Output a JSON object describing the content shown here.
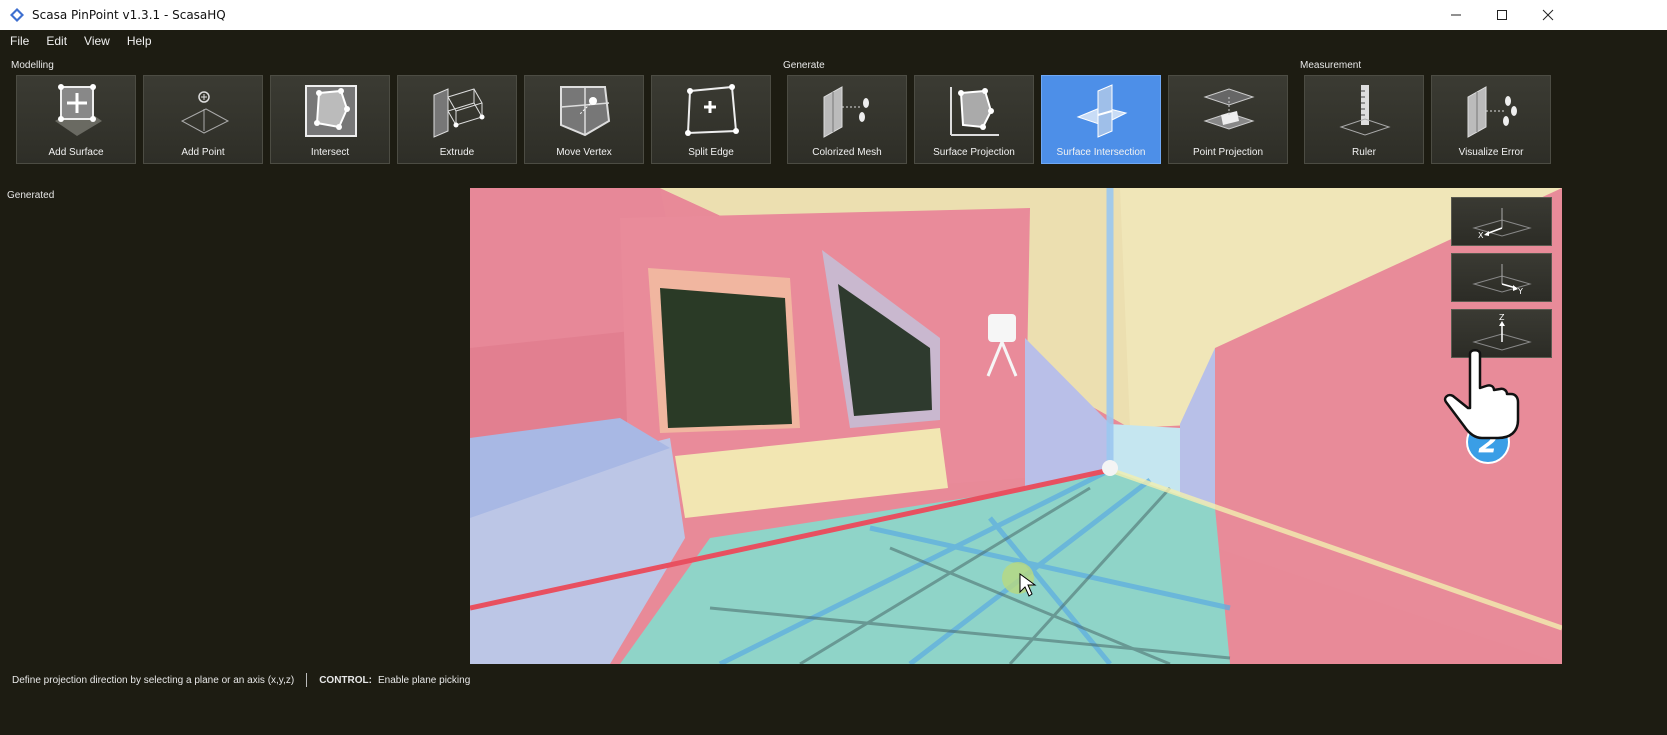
{
  "window": {
    "title": "Scasa PinPoint v1.3.1 - ScasaHQ",
    "controls": [
      "minimize",
      "maximize",
      "close"
    ]
  },
  "menu": [
    "File",
    "Edit",
    "View",
    "Help"
  ],
  "ribbon": {
    "groups": [
      {
        "label": "Modelling",
        "tools": [
          "Add Surface",
          "Add Point",
          "Intersect",
          "Extrude",
          "Move Vertex",
          "Split Edge"
        ]
      },
      {
        "label": "Generate",
        "tools": [
          "Colorized Mesh",
          "Surface Projection",
          "Surface Intersection",
          "Point Projection"
        ]
      },
      {
        "label": "Measurement",
        "tools": [
          "Ruler",
          "Visualize Error"
        ]
      }
    ],
    "active_tool": "Surface Intersection"
  },
  "panel": {
    "title": "Generated"
  },
  "viewport": {
    "axis_buttons": [
      {
        "name": "x-axis-button",
        "label": "X"
      },
      {
        "name": "y-axis-button",
        "label": "Y"
      },
      {
        "name": "z-axis-button",
        "label": "Z"
      }
    ],
    "step_badge": "2"
  },
  "status": {
    "message": "Define projection direction by selecting a plane or an axis (x,y,z)",
    "key": "CONTROL:",
    "key_hint": "Enable plane picking"
  },
  "colors": {
    "background": "#1d1c12",
    "accent": "#4d8fe8",
    "wall_pink": "#e88a98",
    "floor_teal": "#8fd4c8"
  }
}
